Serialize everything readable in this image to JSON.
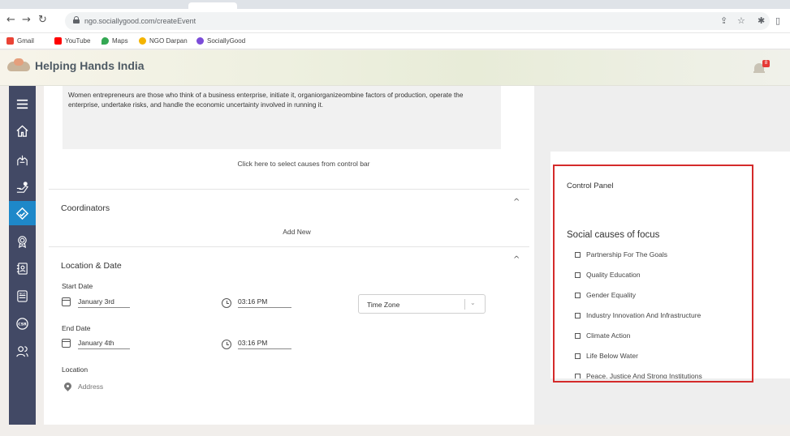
{
  "browser": {
    "url": "ngo.sociallygood.com/createEvent",
    "bookmarks": [
      {
        "label": "Gmail",
        "color": "#ea4335"
      },
      {
        "label": "YouTube",
        "color": "#ff0000"
      },
      {
        "label": "Maps",
        "color": "#34a853"
      },
      {
        "label": "NGO Darpan",
        "color": "#f4b400"
      },
      {
        "label": "SociallyGood",
        "color": "#7b4cd9"
      }
    ]
  },
  "header": {
    "title": "Helping Hands India",
    "notification_count": "8"
  },
  "sidebar": {
    "items": [
      "menu-icon",
      "home-icon",
      "hands-icon",
      "fundraise-icon",
      "event-icon",
      "award-icon",
      "contacts-icon",
      "ngo-icon",
      "csr-icon",
      "volunteers-icon"
    ],
    "active_index": 4
  },
  "form": {
    "description": "Women entrepreneurs are those who think of a business enterprise, initiate it, organiorganizeombine factors of production, operate the enterprise, undertake risks, and handle the economic uncertainty involved in running it.",
    "causes_hint": "Click here to select causes from control bar",
    "coordinators": {
      "title": "Coordinators",
      "add_new": "Add New"
    },
    "location_date": {
      "title": "Location & Date",
      "start_date_label": "Start Date",
      "start_date": "January 3rd",
      "start_time": "03:16 PM",
      "timezone_placeholder": "Time Zone",
      "end_date_label": "End Date",
      "end_date": "January 4th",
      "end_time": "03:16 PM",
      "location_label": "Location",
      "address_placeholder": "Address"
    }
  },
  "control_panel": {
    "title": "Control Panel",
    "causes_title": "Social causes of focus",
    "causes": [
      "Partnership For The Goals",
      "Quality Education",
      "Gender Equality",
      "Industry Innovation And Infrastructure",
      "Climate Action",
      "Life Below Water",
      "Peace, Justice And Strong Institutions"
    ],
    "highlight_color": "#d42a2a"
  }
}
